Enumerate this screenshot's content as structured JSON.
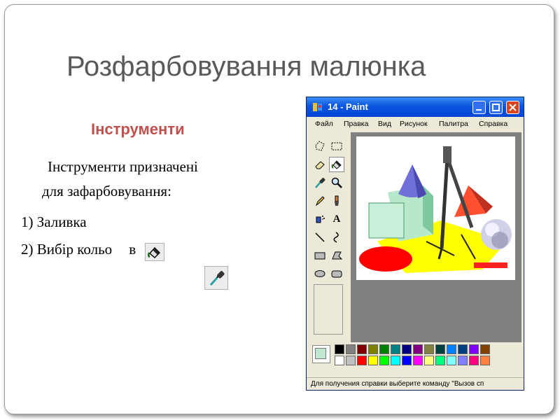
{
  "slide": {
    "title": "Розфарбовування малюнка",
    "subtitle": "Інструменти",
    "paragraph_line1": "Інструменти призначені",
    "paragraph_line2": "для зафарбовування:",
    "item1": "1) Заливка",
    "item2_part1": "2) Вибір кольо",
    "item2_part2": "в",
    "accent_color": "#c0504d",
    "title_color": "#595959"
  },
  "paint": {
    "window_title": "14 - Paint",
    "title_buttons": [
      "minimize",
      "maximize",
      "close"
    ],
    "menu": [
      "Файл",
      "Правка",
      "Вид",
      "Рисунок",
      "Палитра",
      "Справка"
    ],
    "tools": [
      "free-select-icon",
      "rect-select-icon",
      "eraser-icon",
      "fill-icon",
      "color-picker-icon",
      "magnifier-icon",
      "pencil-icon",
      "brush-icon",
      "airbrush-icon",
      "text-icon",
      "line-icon",
      "curve-icon",
      "rectangle-icon",
      "polygon-icon",
      "ellipse-icon",
      "rounded-rect-icon"
    ],
    "text_tool_glyph": "A",
    "palette_top": [
      "#000000",
      "#808080",
      "#800000",
      "#808000",
      "#008000",
      "#008080",
      "#000080",
      "#800080",
      "#808040",
      "#004040",
      "#0080ff",
      "#004080",
      "#8000ff",
      "#804000"
    ],
    "palette_bottom": [
      "#ffffff",
      "#c0c0c0",
      "#ff0000",
      "#ffff00",
      "#00ff00",
      "#00ffff",
      "#0000ff",
      "#ff00ff",
      "#ffff80",
      "#00ff80",
      "#80ffff",
      "#8080ff",
      "#ff0080",
      "#ff8040"
    ],
    "current_color": "#c0e8d0",
    "status": "Для получения справки выберите команду \"Вызов сп"
  }
}
